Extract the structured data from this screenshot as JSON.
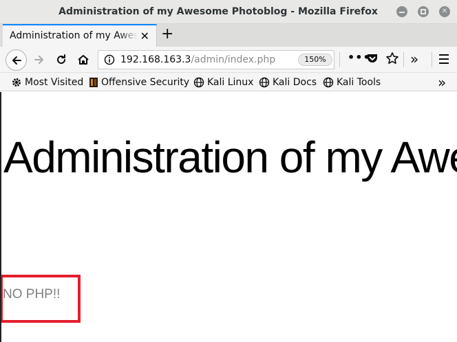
{
  "window": {
    "title": "Administration of my Awesome Photoblog - Mozilla Firefox"
  },
  "tab": {
    "label": "Administration of my Awesome Photoblog",
    "close_icon": "close-icon",
    "new_tab_icon": "plus-icon"
  },
  "navbar": {
    "url_host": "192.168.163.3",
    "url_path": "/admin/index.php",
    "zoom": "150%",
    "more_label": "•••"
  },
  "bookmarks": [
    {
      "label": "Most Visited",
      "icon": "gear-icon"
    },
    {
      "label": "Offensive Security",
      "icon": "offsec-icon"
    },
    {
      "label": "Kali Linux",
      "icon": "globe-icon"
    },
    {
      "label": "Kali Docs",
      "icon": "globe-icon"
    },
    {
      "label": "Kali Tools",
      "icon": "globe-icon"
    }
  ],
  "page": {
    "heading": "Administration of my Awesome Photoblog",
    "message": "NO PHP!!"
  },
  "colors": {
    "accent": "#0a84ff",
    "highlight": "#e41e2c",
    "message_text": "#808080"
  }
}
